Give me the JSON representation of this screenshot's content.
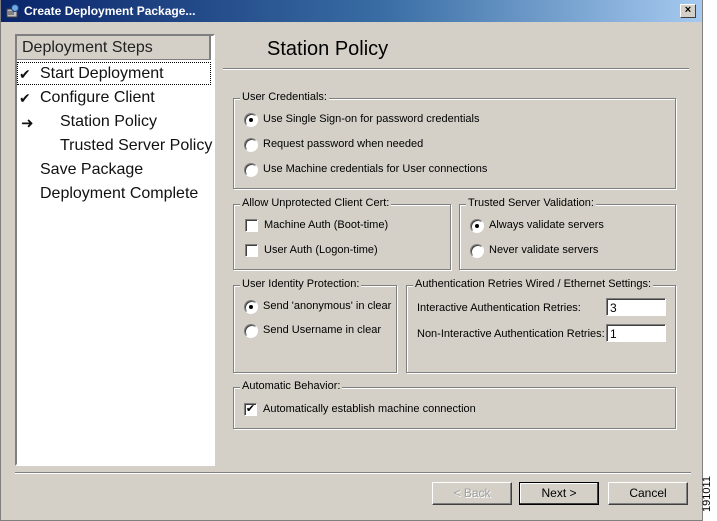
{
  "window": {
    "title": "Create Deployment Package...",
    "close_glyph": "×"
  },
  "steps": {
    "header": "Deployment Steps",
    "items": [
      {
        "label": "Start Deployment",
        "state": "done",
        "mark": "✔"
      },
      {
        "label": "Configure Client",
        "state": "done",
        "mark": "✔"
      },
      {
        "label": "Station Policy",
        "state": "current",
        "mark": "➜"
      },
      {
        "label": "Trusted Server Policy",
        "state": "pending",
        "mark": ""
      },
      {
        "label": "Save Package",
        "state": "pending",
        "mark": ""
      },
      {
        "label": "Deployment Complete",
        "state": "pending",
        "mark": ""
      }
    ]
  },
  "page": {
    "title": "Station Policy"
  },
  "user_credentials": {
    "legend": "User Credentials:",
    "options": [
      {
        "label": "Use Single Sign-on for password credentials",
        "selected": true
      },
      {
        "label": "Request password when needed",
        "selected": false
      },
      {
        "label": "Use Machine credentials for User connections",
        "selected": false
      }
    ]
  },
  "unprotected_cert": {
    "legend": "Allow Unprotected Client Cert:",
    "options": [
      {
        "label": "Machine Auth (Boot-time)",
        "checked": false
      },
      {
        "label": "User Auth (Logon-time)",
        "checked": false
      }
    ]
  },
  "trusted_server": {
    "legend": "Trusted Server Validation:",
    "options": [
      {
        "label": "Always validate servers",
        "selected": true
      },
      {
        "label": "Never validate servers",
        "selected": false
      }
    ]
  },
  "identity_protection": {
    "legend": "User Identity Protection:",
    "options": [
      {
        "label": "Send 'anonymous' in clear",
        "selected": true
      },
      {
        "label": "Send Username in clear",
        "selected": false
      }
    ]
  },
  "auth_retries": {
    "legend": "Authentication Retries Wired / Ethernet Settings:",
    "interactive_label": "Interactive Authentication Retries:",
    "interactive_value": "3",
    "noninteractive_label": "Non-Interactive Authentication Retries:",
    "noninteractive_value": "1"
  },
  "automatic_behavior": {
    "legend": "Automatic Behavior:",
    "option": {
      "label": "Automatically establish machine connection",
      "checked": true
    }
  },
  "buttons": {
    "back": "< Back",
    "next": "Next >",
    "cancel": "Cancel"
  },
  "figure_id": "191011",
  "colors": {
    "title_bar_start": "#0a246a",
    "title_bar_end": "#a6caf0",
    "dialog_bg": "#d4d0c8"
  }
}
